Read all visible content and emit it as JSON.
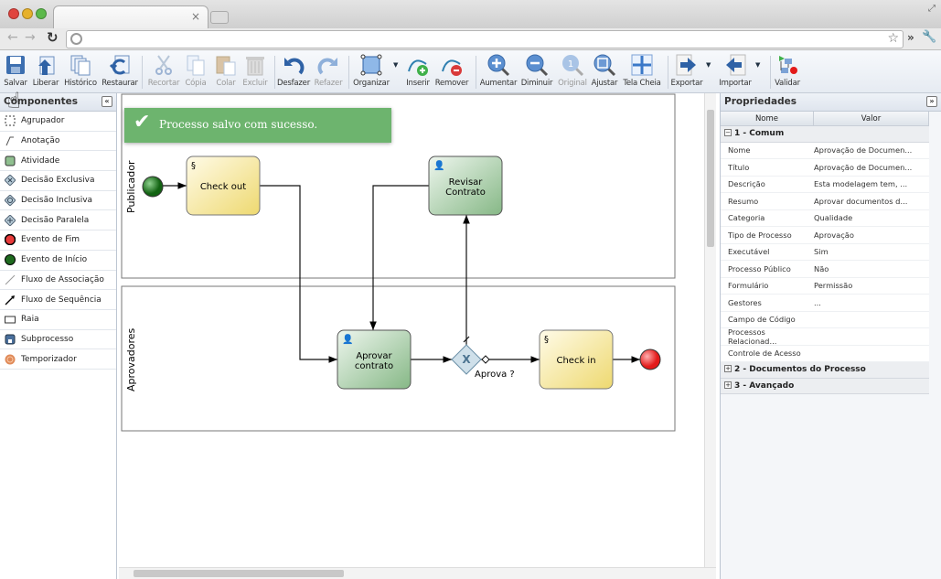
{
  "browser": {
    "tab_close": "×"
  },
  "toolbar": {
    "buttons": [
      {
        "label": "Salvar",
        "icon": "save-icon"
      },
      {
        "label": "Liberar",
        "icon": "release-icon"
      },
      {
        "label": "Histórico",
        "icon": "history-icon"
      },
      {
        "label": "Restaurar",
        "icon": "restore-icon"
      },
      {
        "label": "Recortar",
        "icon": "cut-icon",
        "disabled": true
      },
      {
        "label": "Cópia",
        "icon": "copy-icon",
        "disabled": true
      },
      {
        "label": "Colar",
        "icon": "paste-icon",
        "disabled": true
      },
      {
        "label": "Excluir",
        "icon": "delete-icon",
        "disabled": true
      },
      {
        "label": "Desfazer",
        "icon": "undo-icon"
      },
      {
        "label": "Refazer",
        "icon": "redo-icon",
        "disabled": true
      },
      {
        "label": "Organizar",
        "icon": "organize-icon"
      },
      {
        "label": "Inserir",
        "icon": "insert-icon"
      },
      {
        "label": "Remover",
        "icon": "remove-icon"
      },
      {
        "label": "Aumentar",
        "icon": "zoom-in-icon"
      },
      {
        "label": "Diminuir",
        "icon": "zoom-out-icon"
      },
      {
        "label": "Original",
        "icon": "zoom-original-icon",
        "disabled": true
      },
      {
        "label": "Ajustar",
        "icon": "zoom-fit-icon"
      },
      {
        "label": "Tela Cheia",
        "icon": "fullscreen-icon"
      },
      {
        "label": "Exportar",
        "icon": "export-icon"
      },
      {
        "label": "Importar",
        "icon": "import-icon"
      },
      {
        "label": "Validar",
        "icon": "validate-icon"
      }
    ]
  },
  "components": {
    "title": "Componentes",
    "items": [
      "Agrupador",
      "Anotação",
      "Atividade",
      "Decisão Exclusiva",
      "Decisão Inclusiva",
      "Decisão Paralela",
      "Evento de Fim",
      "Evento de Início",
      "Fluxo de Associação",
      "Fluxo de Sequência",
      "Raia",
      "Subprocesso",
      "Temporizador"
    ]
  },
  "toast": {
    "message": "Processo salvo com sucesso."
  },
  "diagram": {
    "lanes": [
      "Publicador",
      "Aprovadores"
    ],
    "tasks": {
      "checkout": "Check out",
      "revisar1": "Revisar",
      "revisar2": "Contrato",
      "aprovar1": "Aprovar",
      "aprovar2": "contrato",
      "checkin": "Check in"
    },
    "gateway_label": "Aprova ?"
  },
  "properties": {
    "title": "Propriedades",
    "col_name": "Nome",
    "col_value": "Valor",
    "groups": [
      {
        "label": "1 - Comum",
        "expanded": true
      },
      {
        "label": "2 - Documentos do Processo",
        "expanded": false
      },
      {
        "label": "3 - Avançado",
        "expanded": false
      }
    ],
    "rows": [
      [
        "Nome",
        "Aprovação de Documen..."
      ],
      [
        "Título",
        "Aprovação de Documen..."
      ],
      [
        "Descrição",
        "Esta modelagem tem, ..."
      ],
      [
        "Resumo",
        "Aprovar documentos d..."
      ],
      [
        "Categoria",
        "Qualidade"
      ],
      [
        "Tipo de Processo",
        "Aprovação"
      ],
      [
        "Executável",
        "Sim"
      ],
      [
        "Processo Público",
        "Não"
      ],
      [
        "Formulário",
        "Permissão"
      ],
      [
        "Gestores",
        "..."
      ],
      [
        "Campo de Código",
        ""
      ],
      [
        "Processos Relacionad...",
        ""
      ],
      [
        "Controle de Acesso",
        ""
      ]
    ]
  },
  "colors": {
    "toast": "#6db46e",
    "task_yellow": "#f0df8f",
    "task_green": "#8fbf8f",
    "start": "#1f7a1f",
    "end": "#e83a3a"
  }
}
